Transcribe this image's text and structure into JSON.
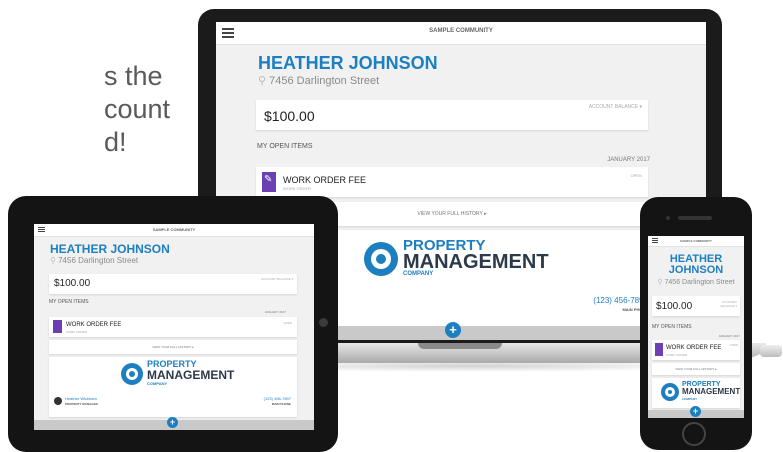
{
  "headline": {
    "line1": "s the",
    "line2": "count",
    "line3": "d!"
  },
  "app": {
    "community": "SAMPLE COMMUNITY",
    "name": "HEATHER JOHNSON",
    "name_line1": "HEATHER",
    "name_line2": "JOHNSON",
    "address": "7456 Darlington Street",
    "balance": "$100.00",
    "balance_label": "ACCOUNT BALANCE ▾",
    "balance_label_short1": "ACCOUNT",
    "balance_label_short2": "BALANCE ▾",
    "open_items_label": "MY OPEN ITEMS",
    "month": "JANUARY 2017",
    "work_order": {
      "title": "WORK ORDER FEE",
      "subtitle": "WORK ORDER",
      "status": "OPEN"
    },
    "history_link": "VIEW YOUR FULL HISTORY ▸",
    "logo": {
      "line1": "PROPERTY",
      "line2": "MANAGEMENT",
      "line3": "COMPANY"
    },
    "contact": {
      "phone": "(123) 456-7897",
      "phone_label": "MAIN PHONE",
      "manager_name": "Heather Wickham",
      "manager_role": "PROPERTY MANAGER"
    }
  },
  "colors": {
    "brand_blue": "#1d7fbf",
    "work_order_purple": "#6c3fb2"
  }
}
